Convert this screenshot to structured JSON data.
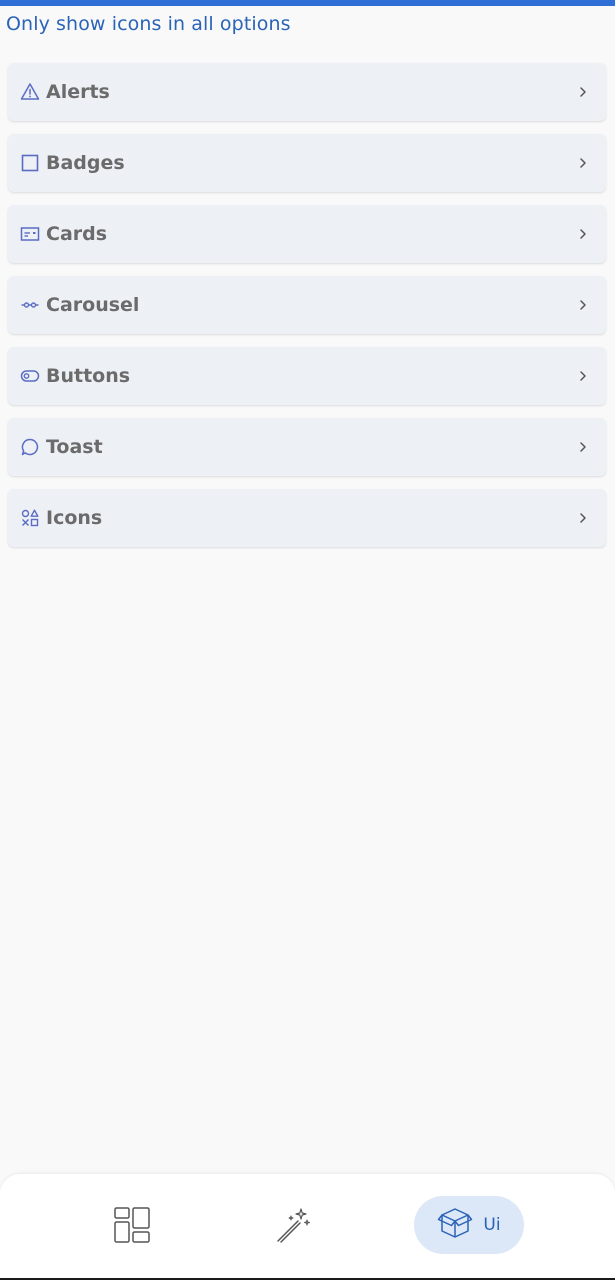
{
  "header": {
    "title": "Only show icons in all options"
  },
  "menu": {
    "items": [
      {
        "label": "Alerts",
        "icon": "alert-triangle-icon"
      },
      {
        "label": "Badges",
        "icon": "square-icon"
      },
      {
        "label": "Cards",
        "icon": "card-icon"
      },
      {
        "label": "Carousel",
        "icon": "carousel-icon"
      },
      {
        "label": "Buttons",
        "icon": "toggle-icon"
      },
      {
        "label": "Toast",
        "icon": "message-circle-icon"
      },
      {
        "label": "Icons",
        "icon": "shapes-icon"
      }
    ]
  },
  "bottom_nav": {
    "items": [
      {
        "icon": "dashboard-icon",
        "label": ""
      },
      {
        "icon": "magic-wand-icon",
        "label": ""
      },
      {
        "icon": "box-icon",
        "label": "Ui"
      }
    ]
  },
  "colors": {
    "accent": "#2f6fd6",
    "icon": "#5b6cc4",
    "item_bg": "#edf0f5",
    "label": "#6b6b6b"
  }
}
